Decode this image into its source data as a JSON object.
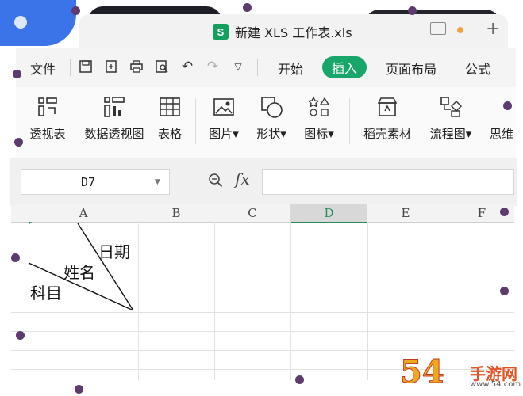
{
  "window": {
    "tab_title": "新建 XLS 工作表.xls",
    "tab_icon_letter": "S"
  },
  "menu": {
    "file": "文件",
    "tabs": [
      "开始",
      "插入",
      "页面布局",
      "公式"
    ],
    "active_tab": "插入"
  },
  "ribbon": {
    "items": [
      {
        "label": "透视表",
        "icon": "pivot-table-icon"
      },
      {
        "label": "数据透视图",
        "icon": "pivot-chart-icon"
      },
      {
        "label": "表格",
        "icon": "table-icon"
      },
      {
        "label": "图片▾",
        "icon": "picture-icon"
      },
      {
        "label": "形状▾",
        "icon": "shape-icon"
      },
      {
        "label": "图标▾",
        "icon": "icon-library-icon"
      },
      {
        "label": "稻壳素材",
        "icon": "docer-material-icon"
      },
      {
        "label": "流程图▾",
        "icon": "flowchart-icon"
      },
      {
        "label": "思维",
        "icon": "mindmap-icon"
      }
    ]
  },
  "formula_bar": {
    "cell_ref": "D7",
    "fx": "fx",
    "value": ""
  },
  "sheet": {
    "columns": [
      "A",
      "B",
      "C",
      "D",
      "E",
      "F"
    ],
    "active_column": "D",
    "cell_a1_text": {
      "date": "日期",
      "name": "姓名",
      "subject": "科目"
    }
  },
  "watermark": {
    "big": "54",
    "small": "手游网",
    "url": "www.54.com"
  },
  "colors": {
    "accent_green": "#19a66a",
    "brand_blue": "#3b73e8"
  }
}
